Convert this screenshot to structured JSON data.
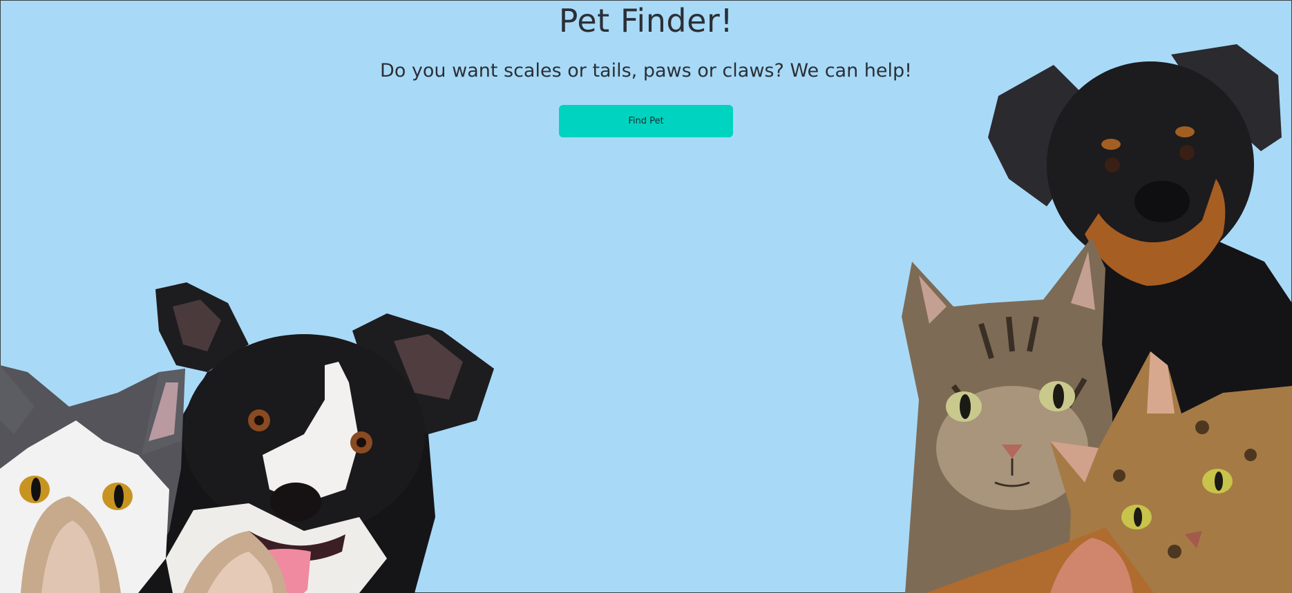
{
  "hero": {
    "title": "Pet Finder!",
    "subtitle": "Do you want scales or tails, paws or claws? We can help!",
    "button_label": "Find Pet"
  },
  "colors": {
    "background": "#a8daf7",
    "button": "#00d4c0",
    "text": "#2b2f36"
  },
  "images": {
    "left": "photo-pets-cat-and-border-collie",
    "right": "photo-pets-rottweiler-and-cats"
  }
}
